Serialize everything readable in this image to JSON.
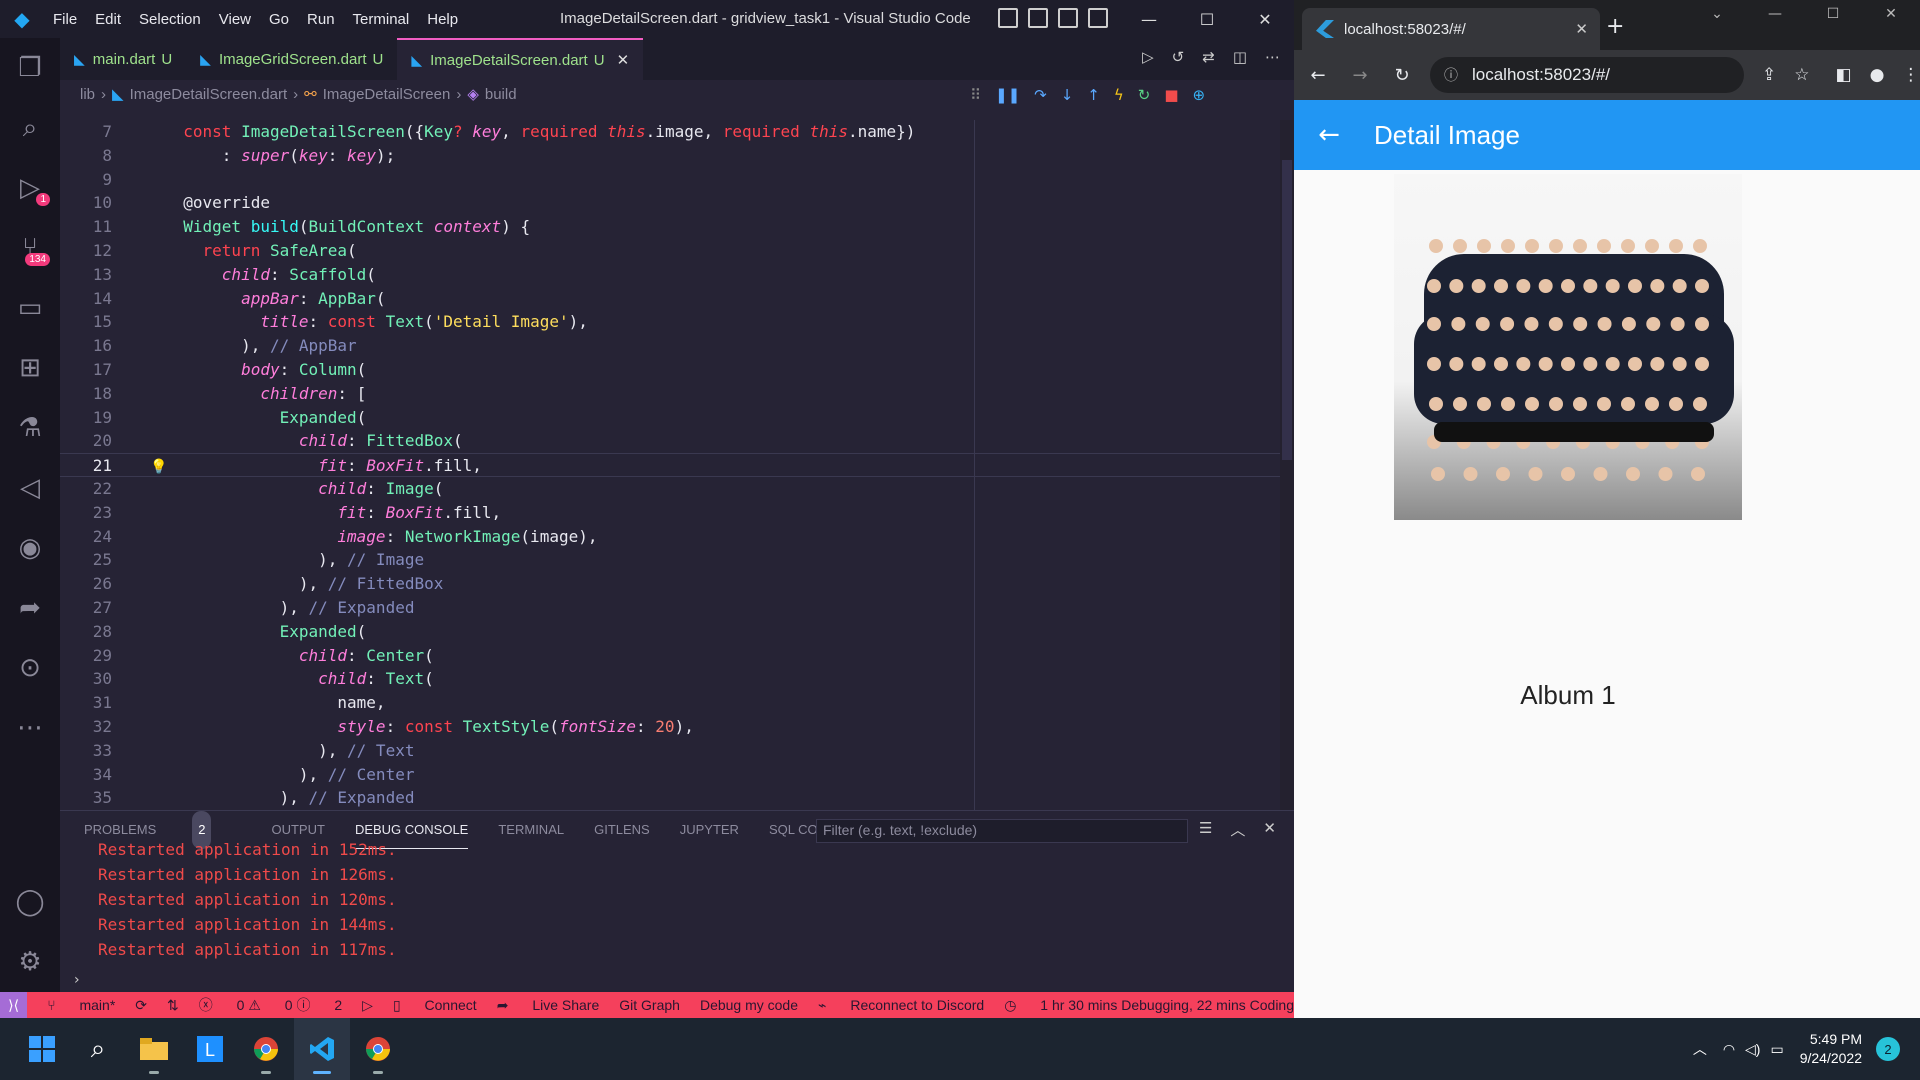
{
  "vscode": {
    "menu": [
      "File",
      "Edit",
      "Selection",
      "View",
      "Go",
      "Run",
      "Terminal",
      "Help"
    ],
    "window_title": "ImageDetailScreen.dart - gridview_task1 - Visual Studio Code",
    "activity_badges": {
      "debug": "1",
      "scm": "134"
    },
    "tabs": [
      {
        "label": "main.dart",
        "status": "U"
      },
      {
        "label": "ImageGridScreen.dart",
        "status": "U"
      },
      {
        "label": "ImageDetailScreen.dart",
        "status": "U"
      }
    ],
    "breadcrumbs": [
      "lib",
      "ImageDetailScreen.dart",
      "ImageDetailScreen",
      "build"
    ],
    "code": [
      {
        "n": "7",
        "parts": [
          [
            "k",
            "  const "
          ],
          [
            "t",
            "ImageDetailScreen"
          ],
          [
            "d",
            "({"
          ],
          [
            "t",
            "Key"
          ],
          [
            "k",
            "? "
          ],
          [
            "p",
            "key"
          ],
          [
            "d",
            ", "
          ],
          [
            "k",
            "required "
          ],
          [
            "th",
            "this"
          ],
          [
            "d",
            ".image, "
          ],
          [
            "k",
            "required "
          ],
          [
            "th",
            "this"
          ],
          [
            "d",
            ".name})"
          ]
        ]
      },
      {
        "n": "8",
        "parts": [
          [
            "d",
            "      : "
          ],
          [
            "p",
            "super"
          ],
          [
            "d",
            "("
          ],
          [
            "p",
            "key"
          ],
          [
            "d",
            ": "
          ],
          [
            "p",
            "key"
          ],
          [
            "d",
            ");"
          ]
        ]
      },
      {
        "n": "9",
        "parts": []
      },
      {
        "n": "10",
        "parts": [
          [
            "d",
            "  @override"
          ]
        ]
      },
      {
        "n": "11",
        "parts": [
          [
            "t",
            "  Widget "
          ],
          [
            "f",
            "build"
          ],
          [
            "d",
            "("
          ],
          [
            "t",
            "BuildContext "
          ],
          [
            "p",
            "context"
          ],
          [
            "d",
            ") {"
          ]
        ]
      },
      {
        "n": "12",
        "parts": [
          [
            "k",
            "    return "
          ],
          [
            "t",
            "SafeArea"
          ],
          [
            "d",
            "("
          ]
        ]
      },
      {
        "n": "13",
        "parts": [
          [
            "p",
            "      child"
          ],
          [
            "d",
            ": "
          ],
          [
            "t",
            "Scaffold"
          ],
          [
            "d",
            "("
          ]
        ]
      },
      {
        "n": "14",
        "parts": [
          [
            "p",
            "        appBar"
          ],
          [
            "d",
            ": "
          ],
          [
            "t",
            "AppBar"
          ],
          [
            "d",
            "("
          ]
        ]
      },
      {
        "n": "15",
        "parts": [
          [
            "p",
            "          title"
          ],
          [
            "d",
            ": "
          ],
          [
            "k",
            "const "
          ],
          [
            "t",
            "Text"
          ],
          [
            "d",
            "("
          ],
          [
            "v",
            "'Detail Image'"
          ],
          [
            "d",
            "),"
          ]
        ]
      },
      {
        "n": "16",
        "parts": [
          [
            "d",
            "        ), "
          ],
          [
            "c",
            "// AppBar"
          ]
        ]
      },
      {
        "n": "17",
        "parts": [
          [
            "p",
            "        body"
          ],
          [
            "d",
            ": "
          ],
          [
            "t",
            "Column"
          ],
          [
            "d",
            "("
          ]
        ]
      },
      {
        "n": "18",
        "parts": [
          [
            "p",
            "          children"
          ],
          [
            "d",
            ": ["
          ]
        ]
      },
      {
        "n": "19",
        "parts": [
          [
            "t",
            "            Expanded"
          ],
          [
            "d",
            "("
          ]
        ]
      },
      {
        "n": "20",
        "parts": [
          [
            "p",
            "              child"
          ],
          [
            "d",
            ": "
          ],
          [
            "t",
            "FittedBox"
          ],
          [
            "d",
            "("
          ]
        ]
      },
      {
        "n": "21",
        "parts": [
          [
            "p",
            "                fit"
          ],
          [
            "d",
            ": "
          ],
          [
            "p",
            "BoxFit"
          ],
          [
            "d",
            ".fill,"
          ]
        ],
        "current": true
      },
      {
        "n": "22",
        "parts": [
          [
            "p",
            "                child"
          ],
          [
            "d",
            ": "
          ],
          [
            "t",
            "Image"
          ],
          [
            "d",
            "("
          ]
        ]
      },
      {
        "n": "23",
        "parts": [
          [
            "p",
            "                  fit"
          ],
          [
            "d",
            ": "
          ],
          [
            "p",
            "BoxFit"
          ],
          [
            "d",
            ".fill,"
          ]
        ]
      },
      {
        "n": "24",
        "parts": [
          [
            "p",
            "                  image"
          ],
          [
            "d",
            ": "
          ],
          [
            "t",
            "NetworkImage"
          ],
          [
            "d",
            "(image),"
          ]
        ]
      },
      {
        "n": "25",
        "parts": [
          [
            "d",
            "                ), "
          ],
          [
            "c",
            "// Image"
          ]
        ]
      },
      {
        "n": "26",
        "parts": [
          [
            "d",
            "              ), "
          ],
          [
            "c",
            "// FittedBox"
          ]
        ]
      },
      {
        "n": "27",
        "parts": [
          [
            "d",
            "            ), "
          ],
          [
            "c",
            "// Expanded"
          ]
        ]
      },
      {
        "n": "28",
        "parts": [
          [
            "t",
            "            Expanded"
          ],
          [
            "d",
            "("
          ]
        ]
      },
      {
        "n": "29",
        "parts": [
          [
            "p",
            "              child"
          ],
          [
            "d",
            ": "
          ],
          [
            "t",
            "Center"
          ],
          [
            "d",
            "("
          ]
        ]
      },
      {
        "n": "30",
        "parts": [
          [
            "p",
            "                child"
          ],
          [
            "d",
            ": "
          ],
          [
            "t",
            "Text"
          ],
          [
            "d",
            "("
          ]
        ]
      },
      {
        "n": "31",
        "parts": [
          [
            "d",
            "                  name,"
          ]
        ]
      },
      {
        "n": "32",
        "parts": [
          [
            "p",
            "                  style"
          ],
          [
            "d",
            ": "
          ],
          [
            "k",
            "const "
          ],
          [
            "t",
            "TextStyle"
          ],
          [
            "d",
            "("
          ],
          [
            "p",
            "fontSize"
          ],
          [
            "d",
            ": "
          ],
          [
            "n",
            "20"
          ],
          [
            "d",
            "),"
          ]
        ]
      },
      {
        "n": "33",
        "parts": [
          [
            "d",
            "                ), "
          ],
          [
            "c",
            "// Text"
          ]
        ]
      },
      {
        "n": "34",
        "parts": [
          [
            "d",
            "              ), "
          ],
          [
            "c",
            "// Center"
          ]
        ]
      },
      {
        "n": "35",
        "parts": [
          [
            "d",
            "            ), "
          ],
          [
            "c",
            "// Expanded"
          ]
        ]
      }
    ],
    "panel_tabs": [
      "PROBLEMS",
      "OUTPUT",
      "DEBUG CONSOLE",
      "TERMINAL",
      "GITLENS",
      "JUPYTER",
      "SQL CONSOLE"
    ],
    "problems_count": "2",
    "filter_placeholder": "Filter (e.g. text, !exclude)",
    "console_lines": [
      "Restarted application in 152ms.",
      "Restarted application in 126ms.",
      "Restarted application in 120ms.",
      "Restarted application in 144ms.",
      "Restarted application in 117ms."
    ],
    "status": {
      "branch": "main*",
      "errors": "0",
      "warnings": "0",
      "infos": "2",
      "connect": "Connect",
      "live_share": "Live Share",
      "git_graph": "Git Graph",
      "debug": "Debug my code",
      "discord": "Reconnect to Discord",
      "time": "1 hr 30 mins Debugging, 22 mins Coding"
    }
  },
  "browser": {
    "tab_title": "localhost:58023/#/",
    "url": "localhost:58023/#/",
    "app_title": "Detail Image",
    "album_name": "Album 1"
  },
  "taskbar": {
    "time": "5:49 PM",
    "date": "9/24/2022",
    "notifications": "2"
  },
  "colors": {
    "status_bar": "#f5405c",
    "app_bar": "#2196f3",
    "editor_bg": "#262335"
  }
}
